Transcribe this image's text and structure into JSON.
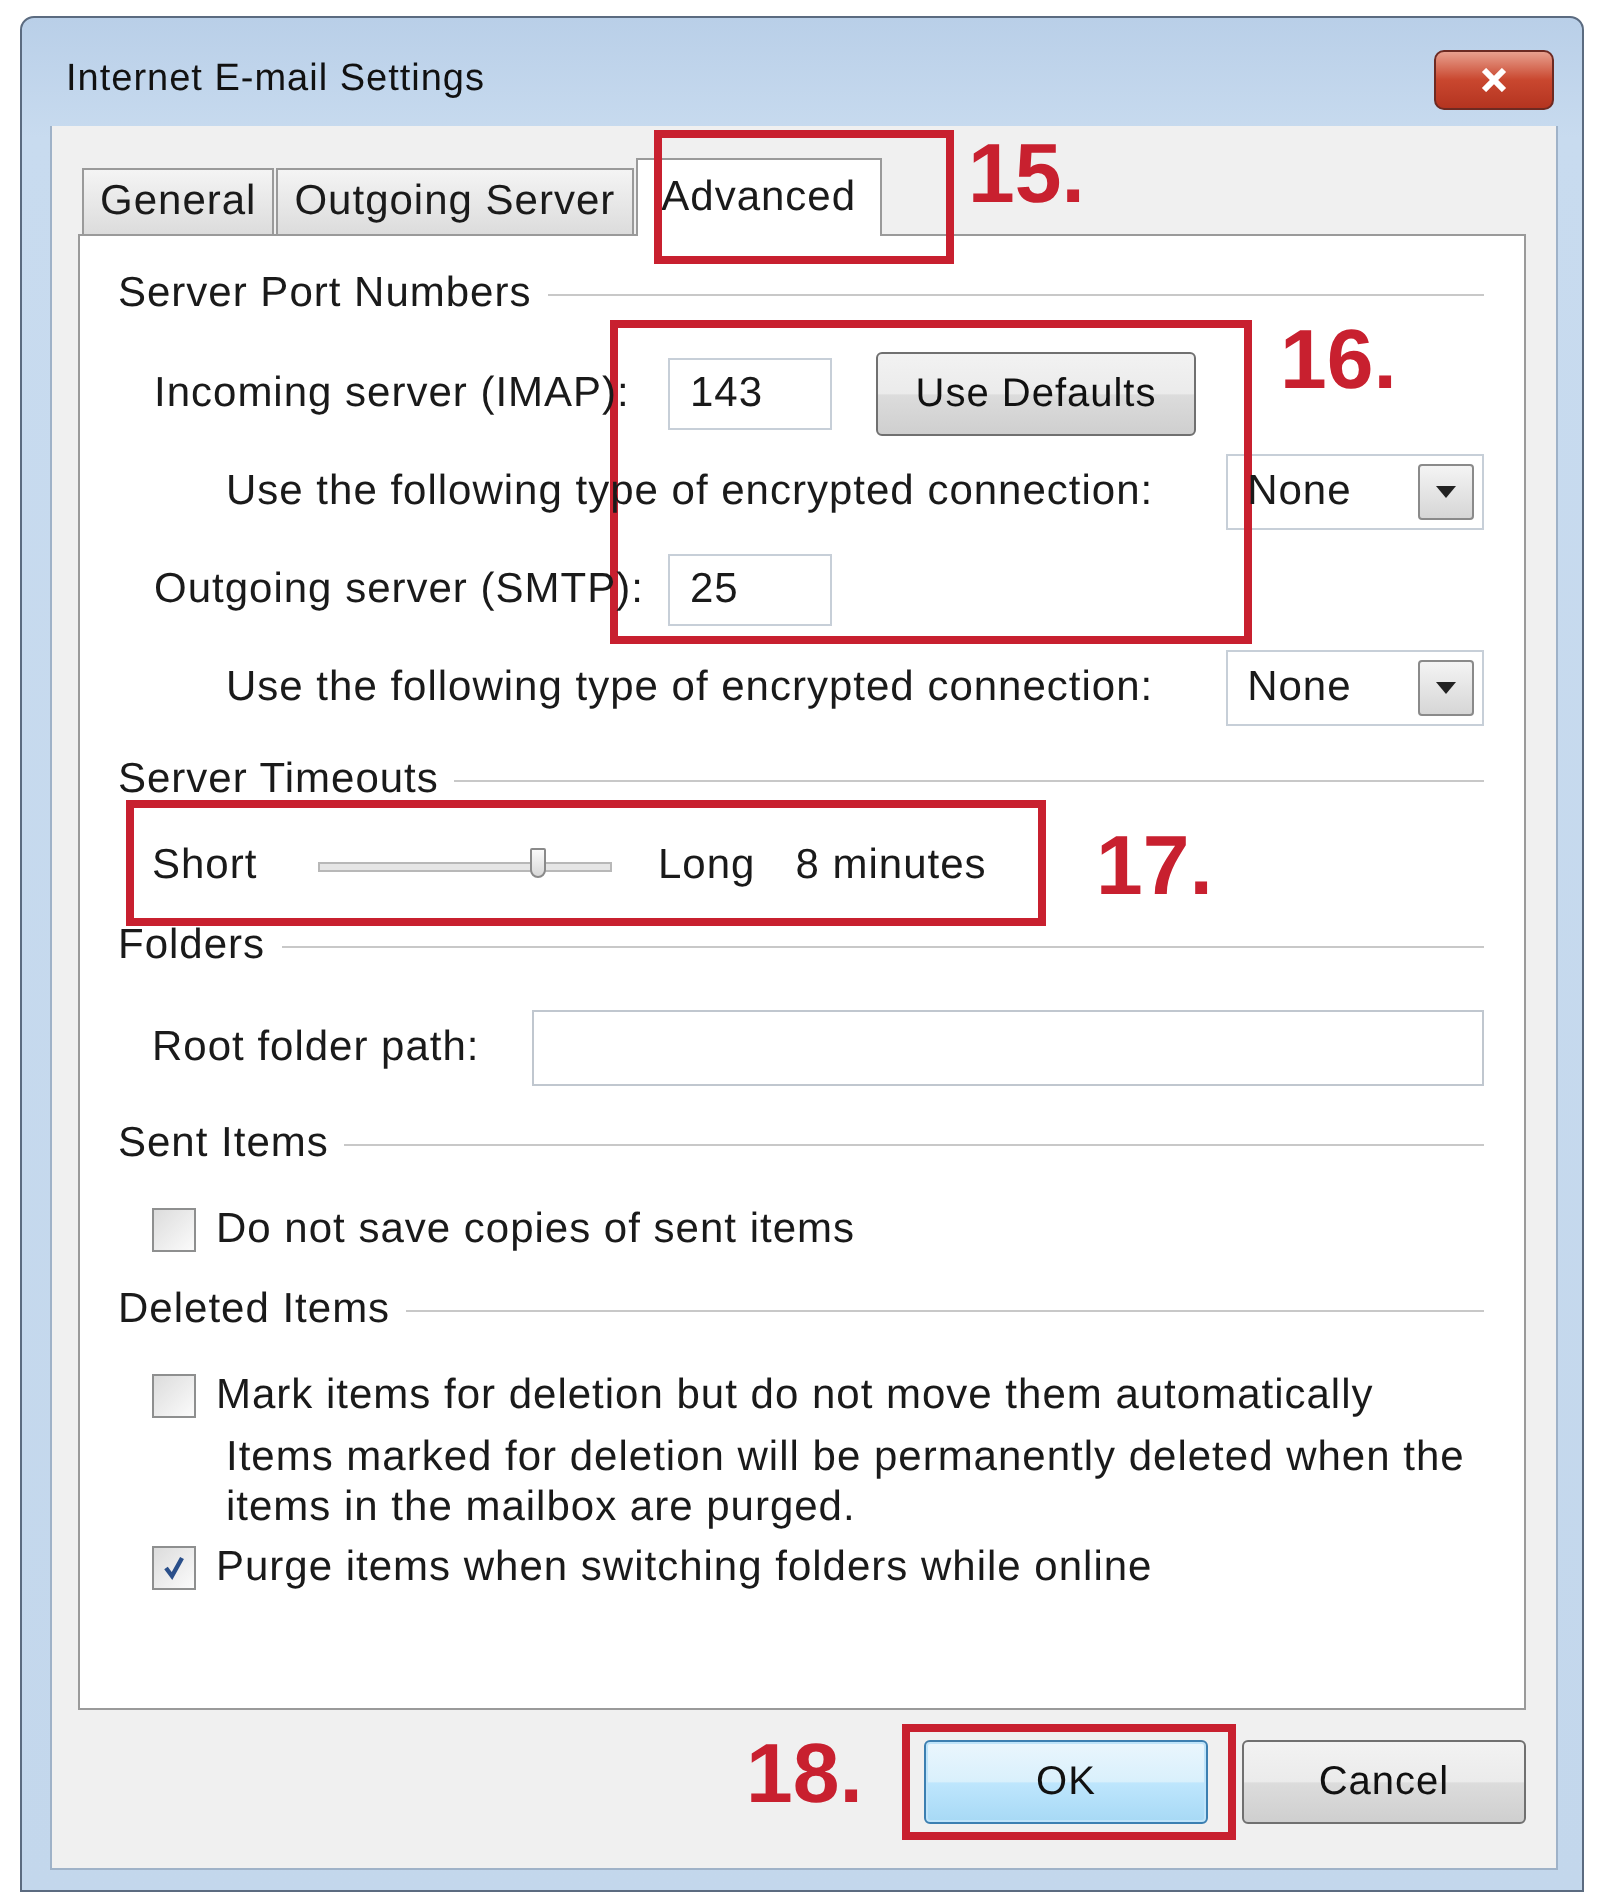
{
  "window": {
    "title": "Internet E-mail Settings"
  },
  "tabs": [
    {
      "label": "General",
      "selected": false
    },
    {
      "label": "Outgoing Server",
      "selected": false
    },
    {
      "label": "Advanced",
      "selected": true
    }
  ],
  "sections": [
    {
      "heading": "Server Port Numbers",
      "rows": [
        {
          "kind": "port",
          "label": "Incoming server (IMAP):",
          "value": "143",
          "button": "Use Defaults"
        },
        {
          "kind": "select",
          "label": "Use the following type of encrypted connection:",
          "value": "None"
        },
        {
          "kind": "port",
          "label": "Outgoing server (SMTP):",
          "value": "25"
        },
        {
          "kind": "select",
          "label": "Use the following type of encrypted connection:",
          "value": "None"
        }
      ]
    },
    {
      "heading": "Server Timeouts",
      "rows": [
        {
          "kind": "slider",
          "min_label": "Short",
          "max_label": "Long",
          "level": 0.75,
          "reading": "8 minutes"
        }
      ]
    },
    {
      "heading": "Folders",
      "rows": [
        {
          "kind": "text",
          "label": "Root folder path:"
        }
      ]
    },
    {
      "heading": "Sent Items",
      "rows": [
        {
          "kind": "checkbox",
          "label": "Do not save copies of sent items",
          "checked": false
        }
      ]
    },
    {
      "heading": "Deleted Items",
      "rows": [
        {
          "kind": "checkbox",
          "label": "Mark items for deletion but do not move them automatically",
          "checked": false,
          "note": "Items marked for deletion will be permanently deleted when the items in the mailbox are purged."
        },
        {
          "kind": "checkbox",
          "label": "Purge items when switching folders while online",
          "checked": true
        }
      ]
    }
  ],
  "buttons": [
    {
      "label": "OK",
      "default": true
    },
    {
      "label": "Cancel",
      "default": false
    }
  ],
  "annotations": [
    {
      "label": "15."
    },
    {
      "label": "16."
    },
    {
      "label": "17."
    },
    {
      "label": "18."
    }
  ]
}
